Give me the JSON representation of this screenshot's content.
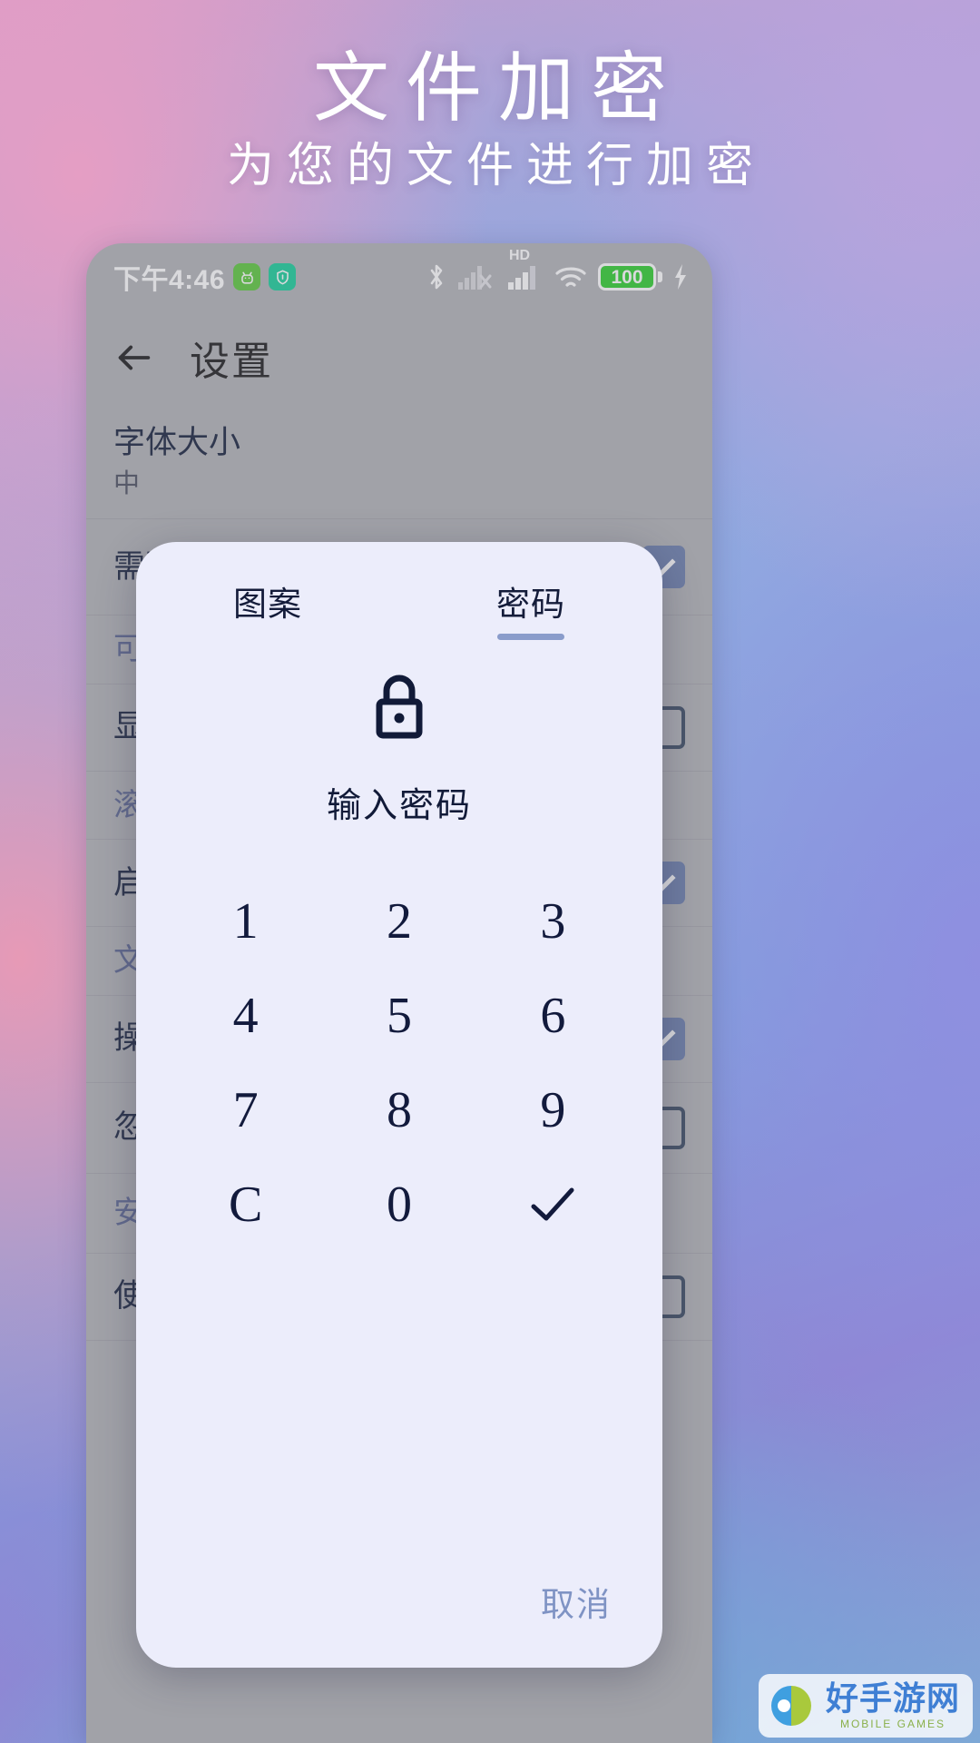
{
  "poster": {
    "title": "文件加密",
    "subtitle": "为您的文件进行加密"
  },
  "phone": {
    "status_bar": {
      "time": "下午4:46",
      "app_icons": [
        {
          "name": "android-robot-icon",
          "glyph": "☺",
          "color": "#5cc93c"
        },
        {
          "name": "security-shield-icon",
          "glyph": "⬢",
          "color": "#18cf9a"
        }
      ],
      "bluetooth": "bluetooth-icon",
      "signal_no_sim": "signal-no-service-icon",
      "hd_label": "HD",
      "signal": "signal-bars-icon",
      "wifi": "wifi-icon",
      "battery_level": "100",
      "charging": "charging-bolt-icon"
    },
    "app_bar": {
      "back": "back-arrow-icon",
      "title": "设置"
    },
    "settings": [
      {
        "title": "字体大小",
        "sub": "中",
        "control": "none"
      },
      {
        "title": "需要按两次返回键才能离开应用程序",
        "sub": "",
        "control": "checkbox-checked"
      },
      {
        "title": "可",
        "sub": "",
        "control": "none"
      },
      {
        "title": "显",
        "sub": "",
        "control": "checkbox"
      },
      {
        "title": "滚",
        "sub": "",
        "control": "none"
      },
      {
        "title": "启",
        "sub": "",
        "control": "checkbox-checked"
      },
      {
        "title": "文",
        "sub": "",
        "control": "none"
      },
      {
        "title": "操",
        "sub": "",
        "control": "checkbox-checked"
      },
      {
        "title": "忽",
        "sub": "",
        "control": "checkbox"
      },
      {
        "title": "安",
        "sub": "",
        "control": "none"
      },
      {
        "title": "使用密码保护 隐藏项",
        "sub": "",
        "control": "checkbox"
      }
    ]
  },
  "dialog": {
    "tabs": [
      {
        "label": "图案",
        "selected": false
      },
      {
        "label": "密码",
        "selected": true
      }
    ],
    "lock_icon": "lock-icon",
    "prompt": "输入密码",
    "keys": [
      "1",
      "2",
      "3",
      "4",
      "5",
      "6",
      "7",
      "8",
      "9",
      "C",
      "0",
      "✓"
    ],
    "confirm_key": "check-icon",
    "cancel_label": "取消"
  },
  "watermark": {
    "title": "好手游网",
    "subtitle": "MOBILE GAMES"
  },
  "colors": {
    "dialog_bg": "#ecedfb",
    "accent": "#8a9ccb",
    "text_dark": "#121a3c",
    "cancel": "#7f93c4",
    "phone_bg": "#b2b3b8"
  }
}
